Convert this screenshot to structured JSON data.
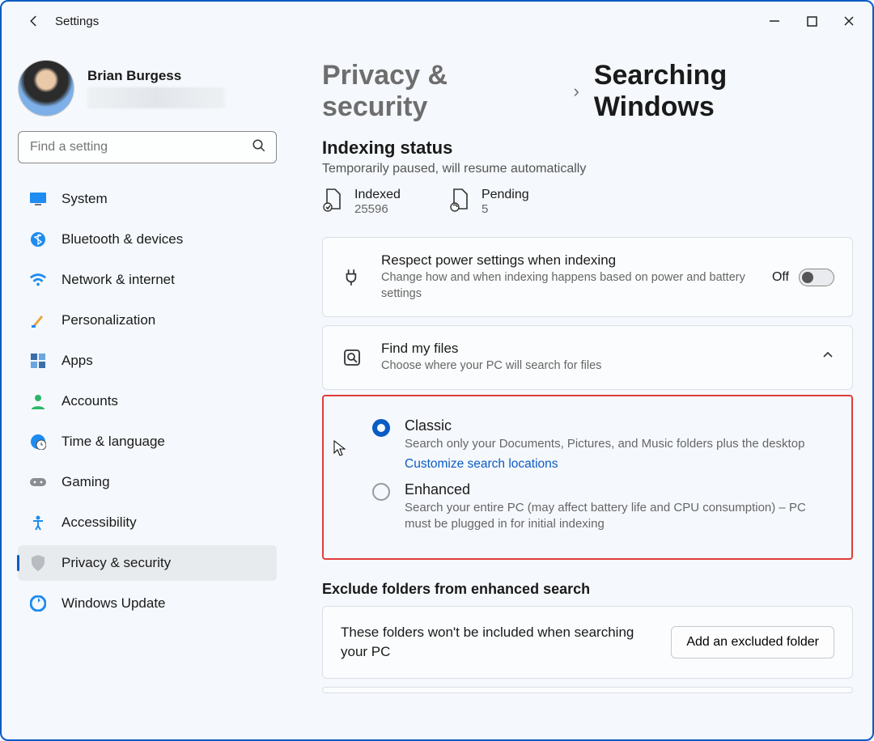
{
  "window": {
    "title": "Settings"
  },
  "user": {
    "name": "Brian Burgess"
  },
  "search": {
    "placeholder": "Find a setting"
  },
  "nav": [
    {
      "key": "system",
      "label": "System"
    },
    {
      "key": "bluetooth",
      "label": "Bluetooth & devices"
    },
    {
      "key": "network",
      "label": "Network & internet"
    },
    {
      "key": "personalize",
      "label": "Personalization"
    },
    {
      "key": "apps",
      "label": "Apps"
    },
    {
      "key": "accounts",
      "label": "Accounts"
    },
    {
      "key": "time",
      "label": "Time & language"
    },
    {
      "key": "gaming",
      "label": "Gaming"
    },
    {
      "key": "accessibility",
      "label": "Accessibility"
    },
    {
      "key": "privacy",
      "label": "Privacy & security"
    },
    {
      "key": "update",
      "label": "Windows Update"
    }
  ],
  "breadcrumb": {
    "parent": "Privacy & security",
    "current": "Searching Windows"
  },
  "indexing": {
    "title": "Indexing status",
    "subtitle": "Temporarily paused, will resume automatically",
    "indexed_label": "Indexed",
    "indexed_value": "25596",
    "pending_label": "Pending",
    "pending_value": "5"
  },
  "power": {
    "title": "Respect power settings when indexing",
    "desc": "Change how and when indexing happens based on power and battery settings",
    "state": "Off"
  },
  "find": {
    "title": "Find my files",
    "desc": "Choose where your PC will search for files",
    "classic": {
      "title": "Classic",
      "desc": "Search only your Documents, Pictures, and Music folders plus the desktop",
      "link": "Customize search locations"
    },
    "enhanced": {
      "title": "Enhanced",
      "desc": "Search your entire PC (may affect battery life and CPU consumption) – PC must be plugged in for initial indexing"
    }
  },
  "exclude": {
    "title": "Exclude folders from enhanced search",
    "desc": "These folders won't be included when searching your PC",
    "button": "Add an excluded folder"
  }
}
